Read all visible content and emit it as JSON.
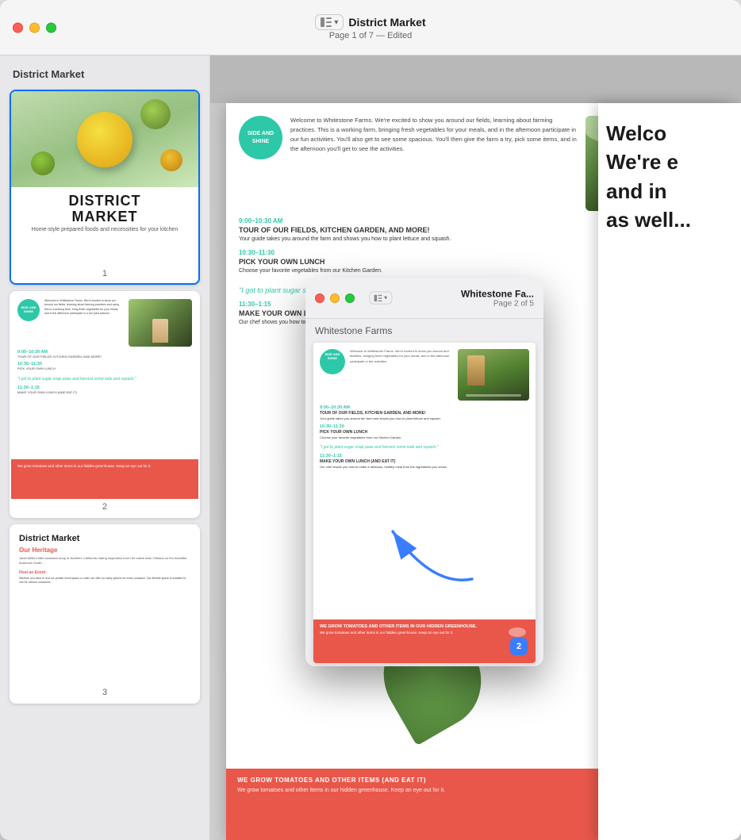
{
  "window": {
    "title": "District Market",
    "subtitle": "Page 1 of 7 — Edited",
    "controls": {
      "close": "close",
      "minimize": "minimize",
      "maximize": "maximize"
    }
  },
  "sidebar": {
    "title": "District Market",
    "pages": [
      {
        "number": "1",
        "type": "cover"
      },
      {
        "number": "2",
        "type": "farm-schedule"
      },
      {
        "number": "3",
        "type": "heritage"
      }
    ]
  },
  "whitestone_window": {
    "title": "Whitestone Fa...",
    "subtitle": "Page 2 of 5",
    "doc_label": "Whitestone Farms",
    "page_badge": "2"
  },
  "canvas": {
    "doc_title": "District Market",
    "page_info": "Page 1 of 7 — Edited"
  },
  "page1": {
    "title": "DISTRICT",
    "title2": "MARKET",
    "subtitle": "Home-style prepared foods and necessities for your kitchen"
  },
  "page2": {
    "time1": "9:00–10:30 AM",
    "label1": "TOUR OF OUR FIELDS, KITCHEN GARDEN, AND MORE!",
    "time2": "10:30–11:30",
    "label2": "PICK YOUR OWN LUNCH",
    "time3": "11:30–1:15",
    "label3": "MAKE YOUR OWN LUNCH (AND EAT IT)",
    "quote": "\"I got to plant sugar snap peas and harvest some kale and squash.\"",
    "footer_text": "We grow tomatoes and other items in our hidden greenhouse. Keep an eye out for it."
  },
  "page3": {
    "title": "District Market",
    "subtitle": "Our Heritage",
    "body": "Janet Miller's little sandwich shop in Northern California, taking inspiration from her native town Orléans on the beautiful American South..."
  },
  "right_partial": {
    "line1": "Welco",
    "line2": "We're e",
    "line3": "and in",
    "line4": "as well..."
  }
}
